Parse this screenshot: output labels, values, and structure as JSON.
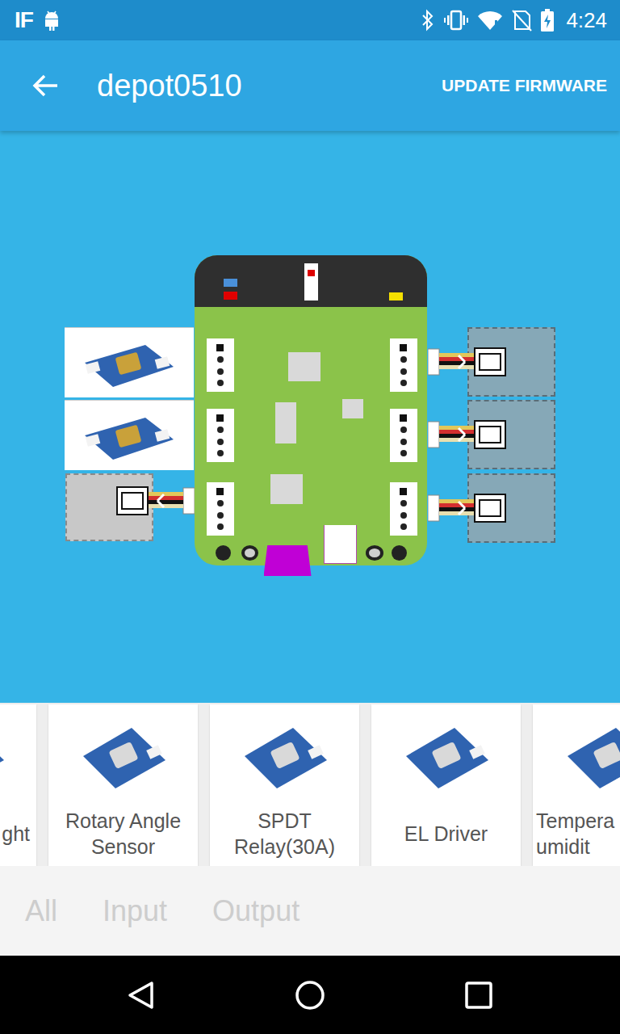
{
  "status_bar": {
    "notification_text": "IF",
    "time": "4:24"
  },
  "app_bar": {
    "title": "depot0510",
    "action": "UPDATE FIRMWARE"
  },
  "board": {
    "left_ports": [
      {
        "occupied": true
      },
      {
        "occupied": true
      },
      {
        "occupied": false
      }
    ],
    "right_ports": [
      {
        "occupied": false
      },
      {
        "occupied": false
      },
      {
        "occupied": false
      }
    ]
  },
  "modules": [
    {
      "label": "ght"
    },
    {
      "label": "Rotary Angle Sensor"
    },
    {
      "label": "SPDT Relay(30A)"
    },
    {
      "label": "EL Driver"
    },
    {
      "label": "Tempera umidit"
    }
  ],
  "filters": [
    {
      "label": "All",
      "selected": false
    },
    {
      "label": "Input",
      "selected": false
    },
    {
      "label": "Output",
      "selected": false
    }
  ]
}
